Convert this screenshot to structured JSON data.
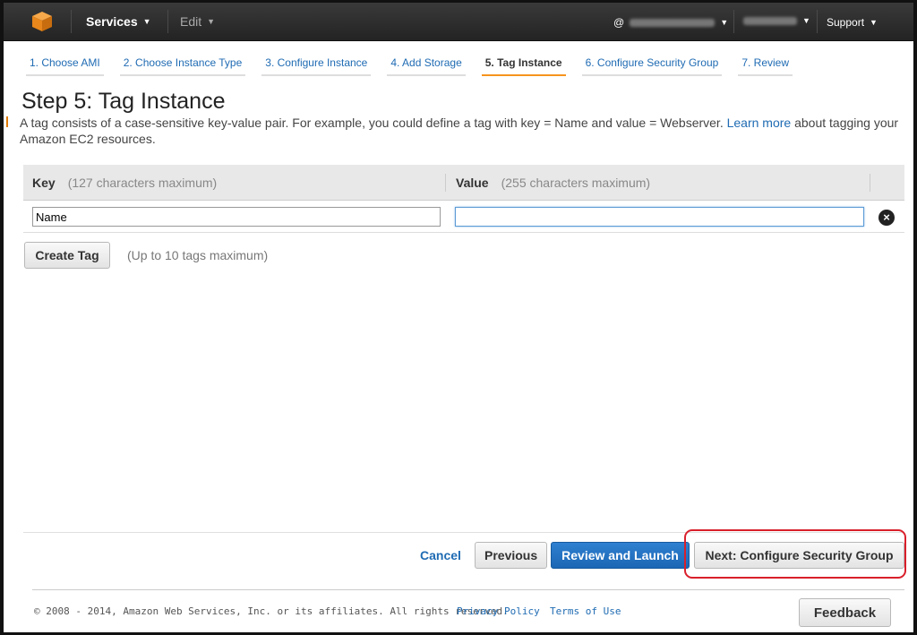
{
  "nav": {
    "services": "Services",
    "edit": "Edit",
    "account_prefix": "@",
    "support": "Support"
  },
  "steps": [
    "1. Choose AMI",
    "2. Choose Instance Type",
    "3. Configure Instance",
    "4. Add Storage",
    "5. Tag Instance",
    "6. Configure Security Group",
    "7. Review"
  ],
  "active_step": 4,
  "page": {
    "title": "Step 5: Tag Instance",
    "desc_before": "A tag consists of a case-sensitive key-value pair. For example, you could define a tag with key = Name and value = Webserver. ",
    "learn_more": "Learn more",
    "desc_after": " about tagging your Amazon EC2 resources."
  },
  "table": {
    "key_header": "Key",
    "key_hint": "(127 characters maximum)",
    "value_header": "Value",
    "value_hint": "(255 characters maximum)",
    "rows": [
      {
        "key": "Name",
        "value": ""
      }
    ]
  },
  "create_tag": "Create Tag",
  "tag_limit": "(Up to 10 tags maximum)",
  "actions": {
    "cancel": "Cancel",
    "previous": "Previous",
    "review_launch": "Review and Launch",
    "next": "Next: Configure Security Group"
  },
  "footer": {
    "copyright": "© 2008 - 2014, Amazon Web Services, Inc. or its affiliates. All rights reserved.",
    "privacy": "Privacy Policy",
    "terms": "Terms of Use",
    "feedback": "Feedback"
  },
  "colors": {
    "link": "#1f6bb3",
    "active_tab": "#f7941e",
    "primary": "#1b66b5",
    "highlight": "#d9202c"
  }
}
